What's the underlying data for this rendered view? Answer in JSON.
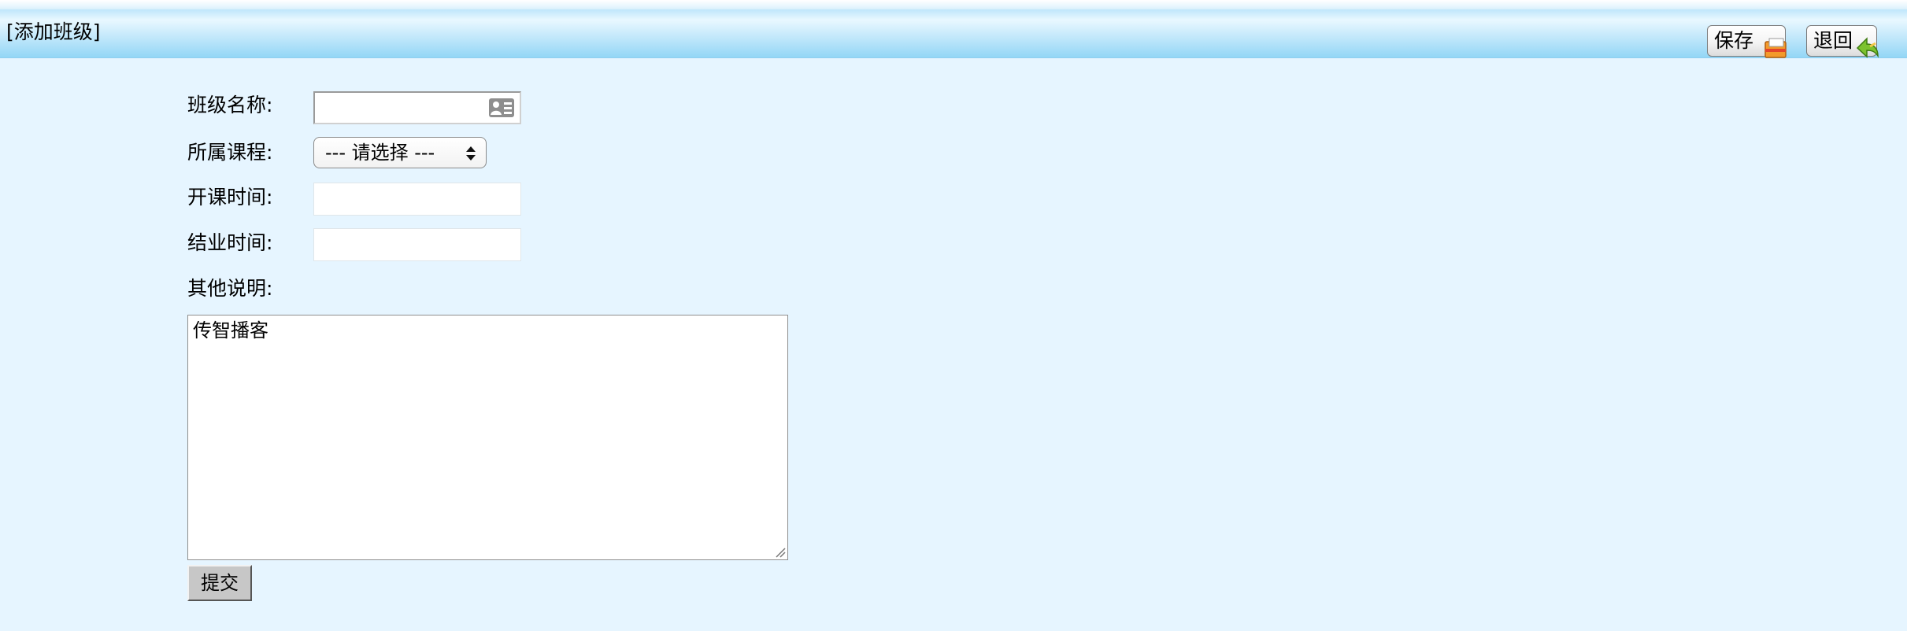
{
  "header": {
    "title": "[添加班级]",
    "save_label": "保存",
    "back_label": "退回"
  },
  "form": {
    "class_name": {
      "label": "班级名称:",
      "value": "",
      "icon": "contact-card-icon"
    },
    "course": {
      "label": "所属课程:",
      "selected": "--- 请选择 ---"
    },
    "start_time": {
      "label": "开课时间:",
      "value": ""
    },
    "end_time": {
      "label": "结业时间:",
      "value": ""
    },
    "notes": {
      "label": "其他说明:",
      "value": "传智播客"
    },
    "submit_label": "提交"
  },
  "colors": {
    "page_background": "#e6f5ff",
    "title_bar_gradient": [
      "#e9f8ff",
      "#93d6f6"
    ]
  }
}
